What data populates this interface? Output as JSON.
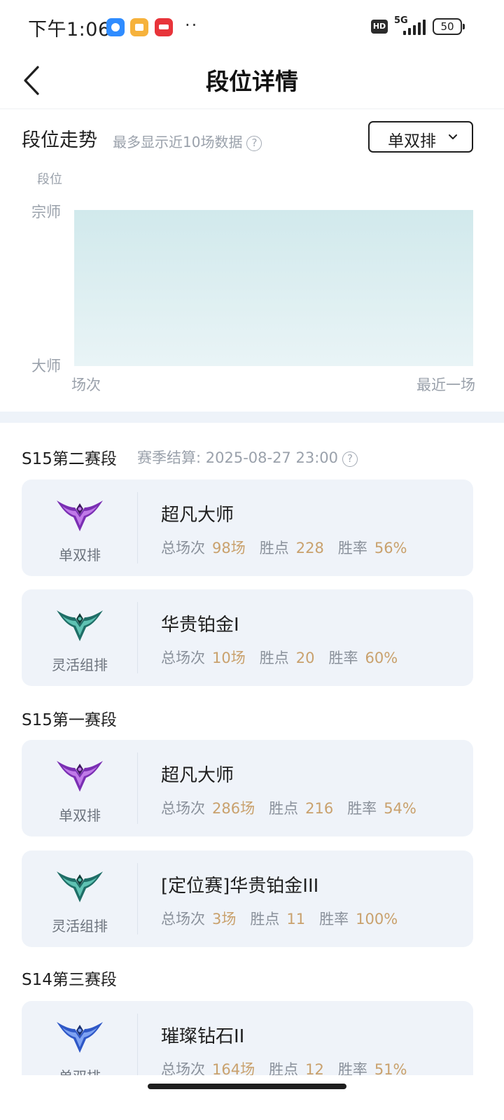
{
  "status_bar": {
    "time": "下午1:06",
    "hd": "HD",
    "network": "5G",
    "battery": "50",
    "dots": "··"
  },
  "header": {
    "title": "段位详情",
    "back_icon": "chevron-left-icon"
  },
  "trend": {
    "title": "段位走势",
    "hint": "最多显示近10场数据",
    "help_icon": "question-circle-icon",
    "queue_selector": "单双排",
    "chevron": "chevron-down-icon"
  },
  "chart_data": {
    "type": "area",
    "ylabel": "段位",
    "y_categories": [
      "大师",
      "宗师"
    ],
    "xlabel_left": "场次",
    "xlabel_right": "最近一场",
    "fill_color": "#d4ebed",
    "series": [
      {
        "values": [
          "宗师",
          "宗师"
        ]
      }
    ]
  },
  "seasons": [
    {
      "name": "S15第二赛段",
      "settle_label": "赛季结算: 2025-08-27 23:00",
      "cards": [
        {
          "queue": "单双排",
          "emblem": "master-emblem-icon",
          "rank": "超凡大师",
          "games_label": "总场次",
          "games": "98场",
          "lp_label": "胜点",
          "lp": "228",
          "winrate_label": "胜率",
          "winrate": "56%"
        },
        {
          "queue": "灵活组排",
          "emblem": "platinum-emblem-icon",
          "rank": "华贵铂金I",
          "games_label": "总场次",
          "games": "10场",
          "lp_label": "胜点",
          "lp": "20",
          "winrate_label": "胜率",
          "winrate": "60%"
        }
      ]
    },
    {
      "name": "S15第一赛段",
      "cards": [
        {
          "queue": "单双排",
          "emblem": "master-emblem-icon",
          "rank": "超凡大师",
          "games_label": "总场次",
          "games": "286场",
          "lp_label": "胜点",
          "lp": "216",
          "winrate_label": "胜率",
          "winrate": "54%"
        },
        {
          "queue": "灵活组排",
          "emblem": "platinum-emblem-icon",
          "rank": "[定位赛]华贵铂金III",
          "games_label": "总场次",
          "games": "3场",
          "lp_label": "胜点",
          "lp": "11",
          "winrate_label": "胜率",
          "winrate": "100%"
        }
      ]
    },
    {
      "name": "S14第三赛段",
      "cards": [
        {
          "queue": "单双排",
          "emblem": "diamond-emblem-icon",
          "rank": "璀璨钻石II",
          "games_label": "总场次",
          "games": "164场",
          "lp_label": "胜点",
          "lp": "12",
          "winrate_label": "胜率",
          "winrate": "51%"
        }
      ]
    }
  ],
  "colors": {
    "accent_value": "#c9a16d",
    "card_bg": "#eff3f9",
    "master": "#8e3fc4",
    "platinum": "#1f6e67",
    "diamond": "#2f58c7"
  }
}
